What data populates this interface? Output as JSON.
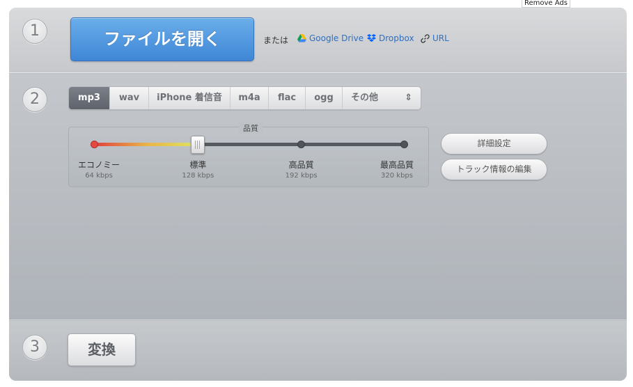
{
  "remove_ads": "Remove Ads",
  "steps": {
    "one": "1",
    "two": "2",
    "three": "3"
  },
  "step1": {
    "open_file": "ファイルを開く",
    "or": "または",
    "sources": {
      "google_drive": "Google Drive",
      "dropbox": "Dropbox",
      "url": "URL"
    }
  },
  "step2": {
    "formats": [
      "mp3",
      "wav",
      "iPhone 着信音",
      "m4a",
      "flac",
      "ogg",
      "その他"
    ],
    "selected_format": "mp3",
    "other_arrow": "⇕",
    "quality": {
      "title": "品質",
      "selected_level": 1,
      "levels": [
        {
          "label": "エコノミー",
          "bitrate": "64 kbps"
        },
        {
          "label": "標準",
          "bitrate": "128 kbps"
        },
        {
          "label": "高品質",
          "bitrate": "192 kbps"
        },
        {
          "label": "最高品質",
          "bitrate": "320 kbps"
        }
      ]
    },
    "advanced_settings": "詳細設定",
    "edit_track_info": "トラック情報の編集"
  },
  "step3": {
    "convert": "変換"
  },
  "colors": {
    "accent_blue": "#4a90e2",
    "link_blue": "#2f6fbf",
    "active_tab": "#60656d"
  }
}
